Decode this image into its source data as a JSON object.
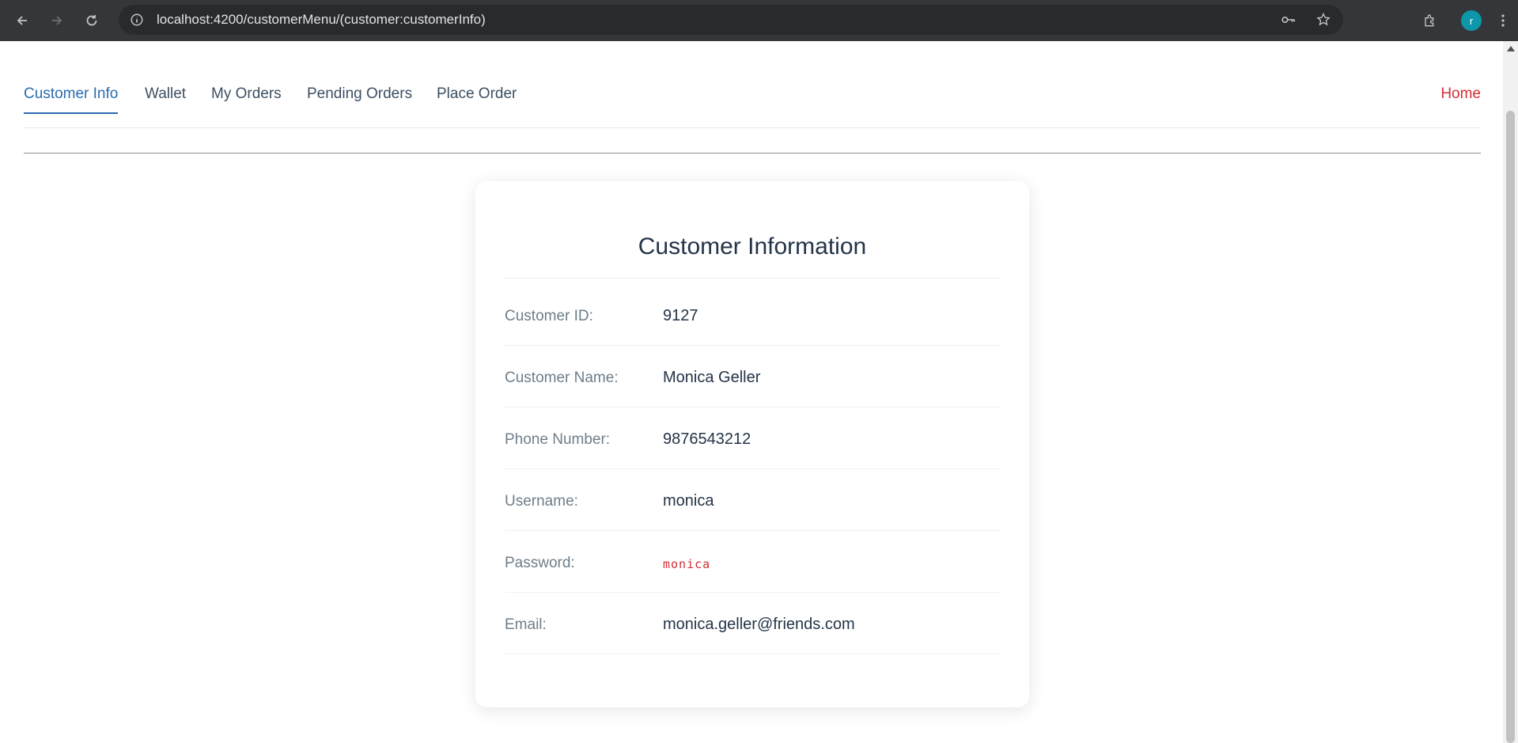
{
  "browser": {
    "url": "localhost:4200/customerMenu/(customer:customerInfo)",
    "profile_initial": "r",
    "icons": [
      "back-icon",
      "forward-icon",
      "reload-icon",
      "info-icon",
      "key-icon",
      "star-icon",
      "extensions-icon",
      "menu-dots-icon"
    ]
  },
  "nav": {
    "tabs": [
      {
        "label": "Customer Info",
        "active": true
      },
      {
        "label": "Wallet",
        "active": false
      },
      {
        "label": "My Orders",
        "active": false
      },
      {
        "label": "Pending Orders",
        "active": false
      },
      {
        "label": "Place Order",
        "active": false
      }
    ],
    "home": "Home"
  },
  "card": {
    "title": "Customer Information",
    "fields": [
      {
        "label": "Customer ID:",
        "value": "9127"
      },
      {
        "label": "Customer Name:",
        "value": "Monica Geller"
      },
      {
        "label": "Phone Number:",
        "value": "9876543212"
      },
      {
        "label": "Username:",
        "value": "monica"
      },
      {
        "label": "Password:",
        "value": "monica"
      },
      {
        "label": "Email:",
        "value": "monica.geller@friends.com"
      }
    ]
  },
  "colors": {
    "accent": "#2b6cb0",
    "home": "#d62d35",
    "password": "#d62d35",
    "text": "#243447"
  }
}
